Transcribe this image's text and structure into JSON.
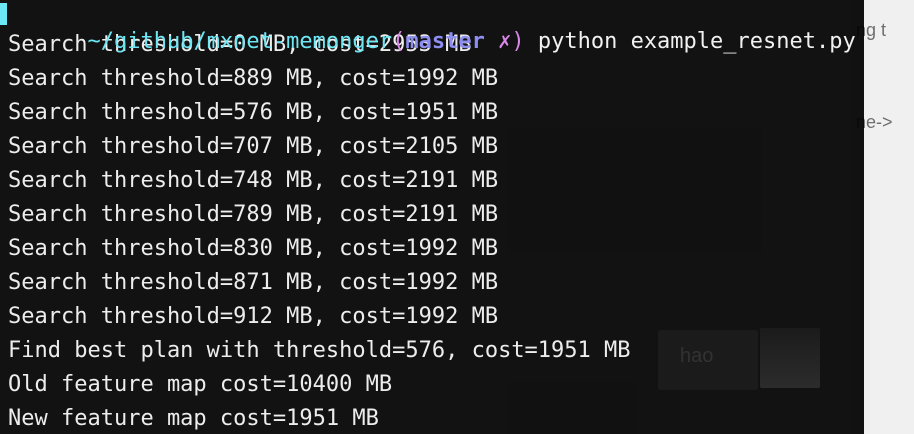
{
  "background_window": {
    "text_1": "ng t",
    "text_2": "ne->"
  },
  "ghost": {
    "label": "hao"
  },
  "terminal": {
    "prompt": {
      "path": "~/github/mxnet-memonger",
      "open_paren": "(",
      "branch": "master",
      "dirty_mark": " ✗",
      "close_paren": ")",
      "command": " python example_resnet.py"
    },
    "output_lines": [
      "Search threshold=0 MB, cost=2953 MB",
      "Search threshold=889 MB, cost=1992 MB",
      "Search threshold=576 MB, cost=1951 MB",
      "Search threshold=707 MB, cost=2105 MB",
      "Search threshold=748 MB, cost=2191 MB",
      "Search threshold=789 MB, cost=2191 MB",
      "Search threshold=830 MB, cost=1992 MB",
      "Search threshold=871 MB, cost=1992 MB",
      "Search threshold=912 MB, cost=1992 MB",
      "Find best plan with threshold=576, cost=1951 MB",
      "Old feature map cost=10400 MB",
      "New feature map cost=1951 MB"
    ]
  }
}
